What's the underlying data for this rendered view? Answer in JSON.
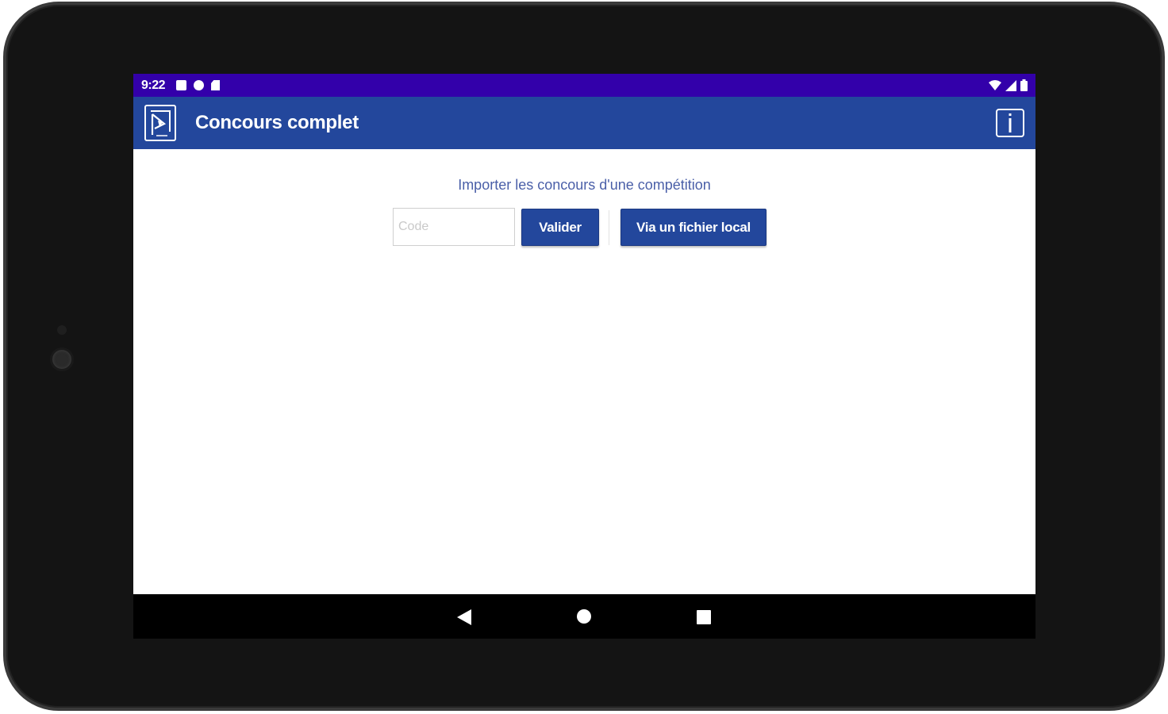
{
  "status_bar": {
    "time": "9:22",
    "icons_left": [
      "notification-icon",
      "data-saver-icon",
      "sd-card-icon"
    ],
    "icons_right": [
      "wifi-icon",
      "signal-icon",
      "battery-icon"
    ]
  },
  "app_bar": {
    "title": "Concours complet",
    "logo_icon": "app-logo-icon",
    "info_icon": "info-icon"
  },
  "import": {
    "label": "Importer les concours d'une compétition",
    "code_placeholder": "Code",
    "code_value": "",
    "validate_label": "Valider",
    "local_file_label": "Via un fichier local"
  },
  "nav_bar": {
    "icons": [
      "back-icon",
      "home-icon",
      "recents-icon"
    ]
  },
  "colors": {
    "status_bar": "#3300aa",
    "app_bar": "#23479c",
    "button": "#23479c",
    "label_text": "#4a5fa8"
  }
}
